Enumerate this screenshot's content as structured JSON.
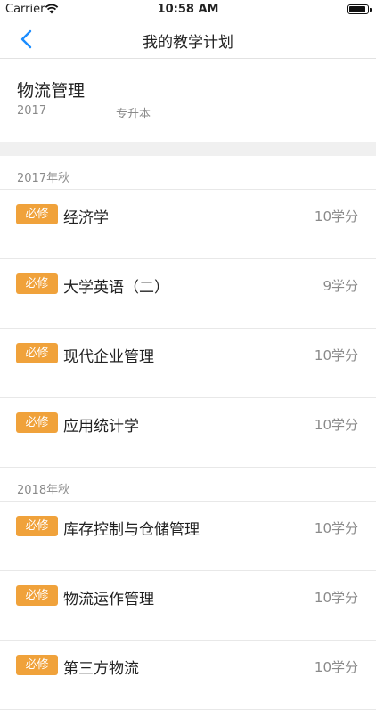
{
  "status_bar": {
    "carrier": "Carrier",
    "time": "10:58 AM",
    "battery_level": 0.95
  },
  "nav": {
    "title": "我的教学计划",
    "back_icon": "chevron-left-icon",
    "accent_color": "#1a8cff"
  },
  "program": {
    "name": "物流管理",
    "year": "2017",
    "level": "专升本"
  },
  "tag_color": "#f0a23b",
  "sections": [
    {
      "title": "2017年秋",
      "courses": [
        {
          "tag": "必修",
          "name": "经济学",
          "credits": "10学分"
        },
        {
          "tag": "必修",
          "name": "大学英语（二）",
          "credits": "9学分"
        },
        {
          "tag": "必修",
          "name": "现代企业管理",
          "credits": "10学分"
        },
        {
          "tag": "必修",
          "name": "应用统计学",
          "credits": "10学分"
        }
      ]
    },
    {
      "title": "2018年秋",
      "courses": [
        {
          "tag": "必修",
          "name": "库存控制与仓储管理",
          "credits": "10学分"
        },
        {
          "tag": "必修",
          "name": "物流运作管理",
          "credits": "10学分"
        },
        {
          "tag": "必修",
          "name": "第三方物流",
          "credits": "10学分"
        }
      ]
    }
  ]
}
